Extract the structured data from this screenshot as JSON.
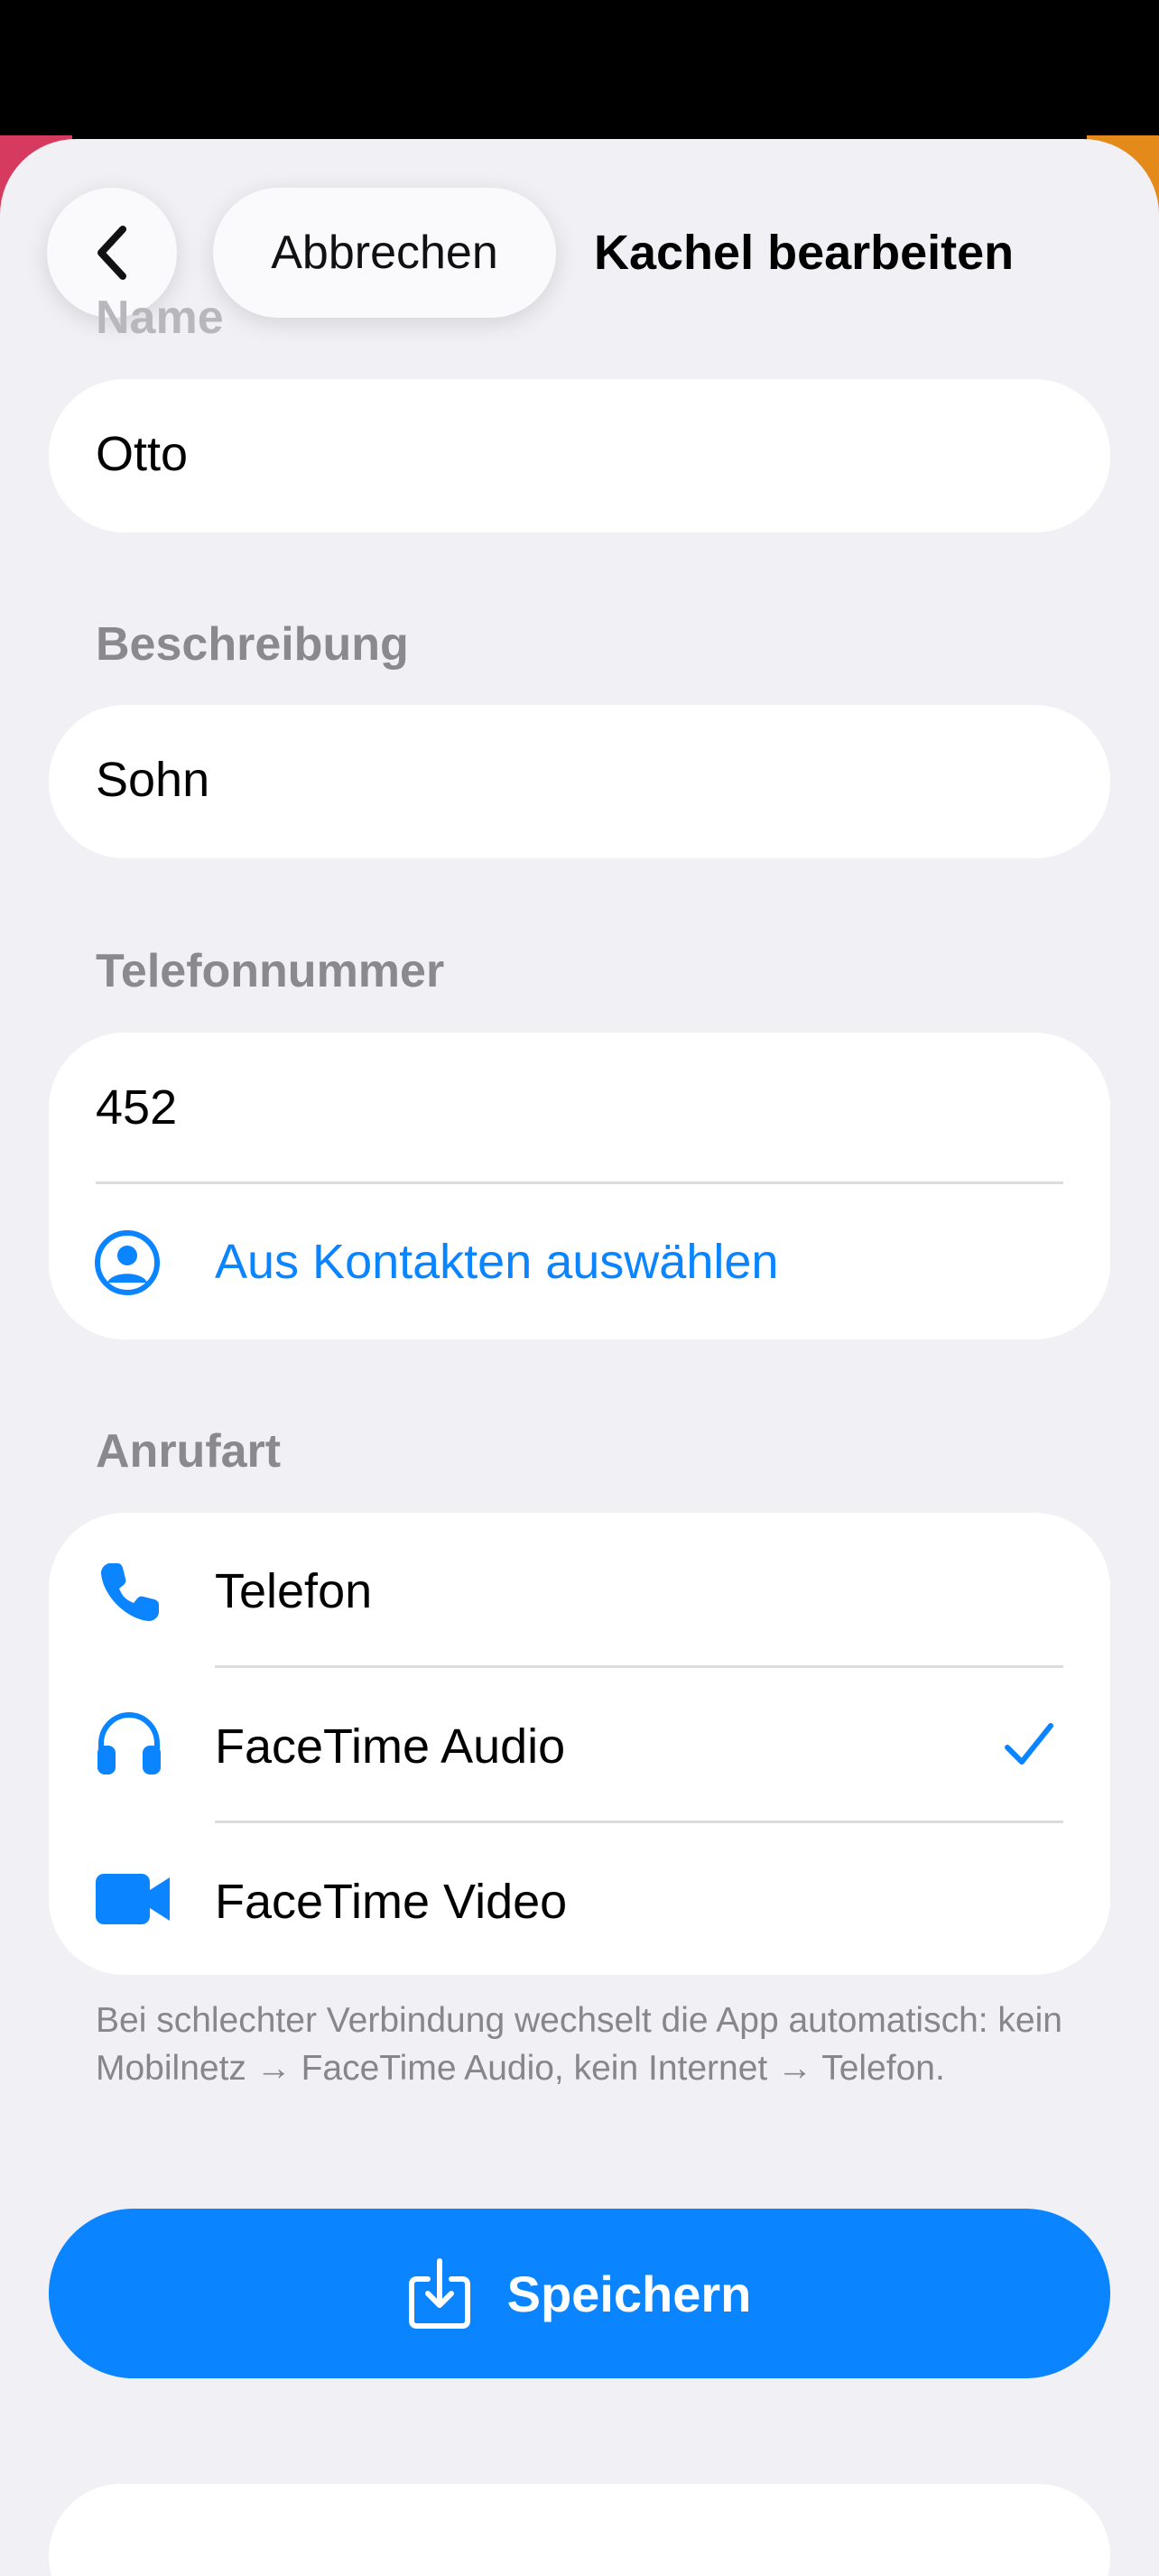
{
  "nav": {
    "cancel_label": "Abbrechen",
    "title": "Kachel bearbeiten"
  },
  "name_section": {
    "label": "Name",
    "value": "Otto"
  },
  "description_section": {
    "label": "Beschreibung",
    "value": "Sohn"
  },
  "phone_section": {
    "label": "Telefonnummer",
    "value": "452",
    "contacts_link": "Aus Kontakten auswählen"
  },
  "call_type_section": {
    "label": "Anrufart",
    "options": [
      {
        "label": "Telefon",
        "icon": "phone-icon",
        "selected": false
      },
      {
        "label": "FaceTime Audio",
        "icon": "headphones-icon",
        "selected": true
      },
      {
        "label": "FaceTime Video",
        "icon": "video-camera-icon",
        "selected": false
      }
    ],
    "footnote": "Bei schlechter Verbindung wechselt die App automatisch: kein Mobilnetz → FaceTime Audio, kein Internet → Telefon."
  },
  "save_button": {
    "label": "Speichern",
    "icon": "save-download-icon"
  },
  "colors": {
    "accent": "#0A84FF",
    "background": "#F0F0F5",
    "card": "#FFFFFF",
    "secondary_text": "#8A8A8E"
  }
}
